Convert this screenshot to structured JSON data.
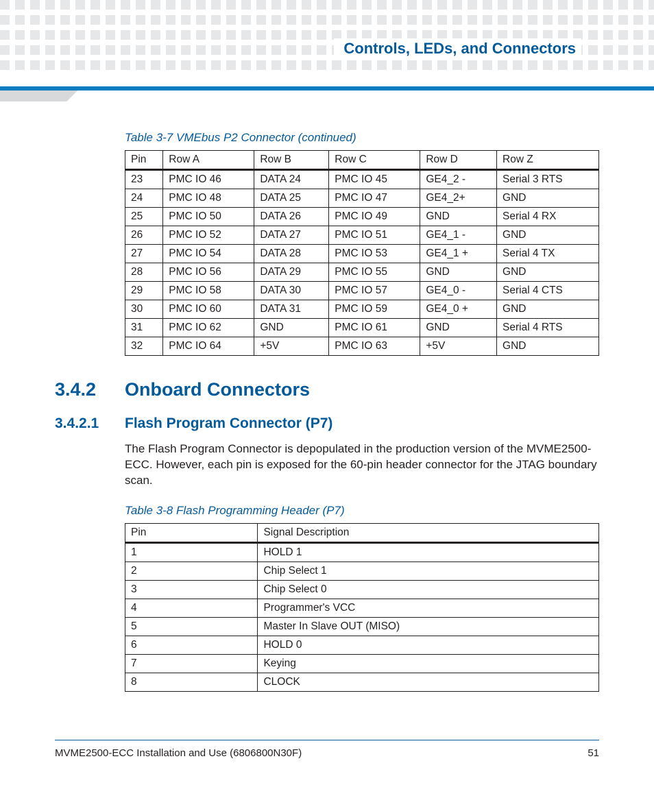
{
  "header": {
    "title": "Controls, LEDs, and Connectors"
  },
  "table7": {
    "caption": "Table 3-7 VMEbus P2 Connector  (continued)",
    "headers": [
      "Pin",
      "Row A",
      "Row B",
      "Row C",
      "Row D",
      "Row Z"
    ],
    "rows": [
      [
        "23",
        "PMC IO 46",
        "DATA 24",
        "PMC IO 45",
        "GE4_2 -",
        "Serial 3 RTS"
      ],
      [
        "24",
        "PMC IO 48",
        "DATA 25",
        "PMC IO 47",
        "GE4_2+",
        "GND"
      ],
      [
        "25",
        "PMC IO 50",
        "DATA 26",
        "PMC IO 49",
        "GND",
        "Serial 4 RX"
      ],
      [
        "26",
        "PMC IO 52",
        "DATA 27",
        "PMC IO 51",
        "GE4_1 -",
        "GND"
      ],
      [
        "27",
        "PMC IO 54",
        "DATA 28",
        "PMC IO 53",
        "GE4_1 +",
        "Serial 4 TX"
      ],
      [
        "28",
        "PMC IO 56",
        "DATA 29",
        "PMC IO 55",
        "GND",
        "GND"
      ],
      [
        "29",
        "PMC IO 58",
        "DATA 30",
        "PMC IO 57",
        "GE4_0 -",
        "Serial 4 CTS"
      ],
      [
        "30",
        "PMC IO 60",
        "DATA 31",
        "PMC IO 59",
        "GE4_0 +",
        "GND"
      ],
      [
        "31",
        "PMC IO 62",
        "GND",
        "PMC IO 61",
        "GND",
        "Serial 4 RTS"
      ],
      [
        "32",
        "PMC IO 64",
        "+5V",
        "PMC IO 63",
        "+5V",
        "GND"
      ]
    ]
  },
  "section342": {
    "num": "3.4.2",
    "title": "Onboard Connectors"
  },
  "section3421": {
    "num": "3.4.2.1",
    "title": "Flash Program Connector (P7)",
    "body": "The Flash Program Connector is depopulated in the production version of the MVME2500-ECC. However, each pin is exposed for the 60-pin header connector for the JTAG boundary scan."
  },
  "table8": {
    "caption": "Table 3-8 Flash Programming Header (P7)",
    "headers": [
      "Pin",
      "Signal Description"
    ],
    "rows": [
      [
        "1",
        "HOLD 1"
      ],
      [
        "2",
        "Chip Select 1"
      ],
      [
        "3",
        "Chip Select 0"
      ],
      [
        "4",
        "Programmer's VCC"
      ],
      [
        "5",
        "Master In Slave OUT (MISO)"
      ],
      [
        "6",
        "HOLD 0"
      ],
      [
        "7",
        "Keying"
      ],
      [
        "8",
        "CLOCK"
      ]
    ]
  },
  "footer": {
    "left": "MVME2500-ECC Installation and Use (6806800N30F)",
    "right": "51"
  }
}
